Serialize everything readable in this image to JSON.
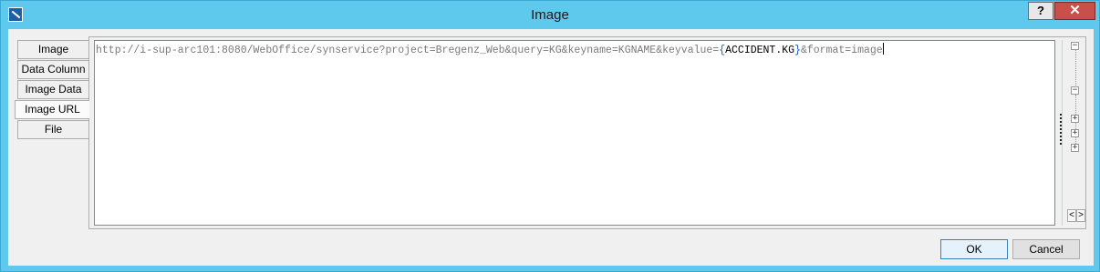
{
  "window": {
    "title": "Image",
    "help_label": "?",
    "close_label": "✕"
  },
  "tabs": [
    {
      "label": "Image",
      "active": false
    },
    {
      "label": "Data Column",
      "active": false
    },
    {
      "label": "Image Data",
      "active": false
    },
    {
      "label": "Image URL",
      "active": true
    },
    {
      "label": "File",
      "active": false
    }
  ],
  "editor": {
    "prefix": "http://i-sup-arc101:8080/WebOffice/synservice?project=Bregenz_Web&query=KG&keyname=KGNAME&keyvalue=",
    "open_brace": "{",
    "field": "ACCIDENT.KG",
    "close_brace": "}",
    "suffix": "&format=image"
  },
  "tree": {
    "collapse_glyph": "−",
    "expand_glyph": "+"
  },
  "scroll": {
    "left": "<",
    "right": ">"
  },
  "buttons": {
    "ok": "OK",
    "cancel": "Cancel"
  }
}
